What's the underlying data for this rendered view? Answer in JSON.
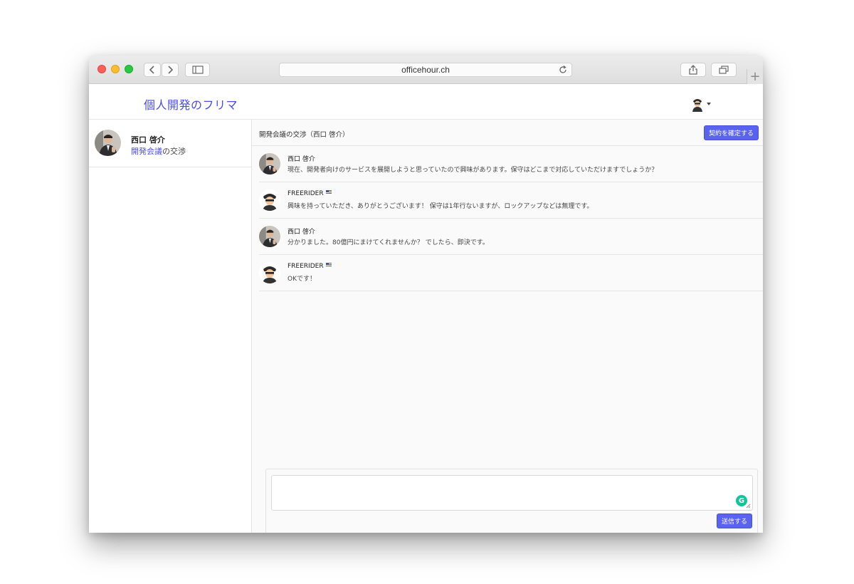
{
  "browser": {
    "url": "officehour.ch"
  },
  "header": {
    "brand": "個人開発のフリマ"
  },
  "sidebar": {
    "conversations": [
      {
        "name": "西口 啓介",
        "link_text": "開発会議",
        "suffix": "の交渉"
      }
    ]
  },
  "main": {
    "title": "開発会議の交渉（西口 啓介）",
    "confirm_label": "契約を確定する",
    "messages": [
      {
        "name": "西口 啓介",
        "text": "現在、開発者向けのサービスを展開しようと思っていたので興味があります。保守はどこまで対応していただけますでしょうか？"
      },
      {
        "name": "FREERIDER",
        "text": "興味を持っていただき、ありがとうございます！ 保守は1年行ないますが、ロックアップなどは無理です。"
      },
      {
        "name": "西口 啓介",
        "text": "分かりました。80億円にまけてくれませんか？ でしたら、即決です。"
      },
      {
        "name": "FREERIDER",
        "text": "OKです！"
      }
    ],
    "send_label": "送信する"
  },
  "colors": {
    "accent": "#4a4ee0",
    "button": "#5a63f0",
    "grammarly": "#15c39a"
  }
}
